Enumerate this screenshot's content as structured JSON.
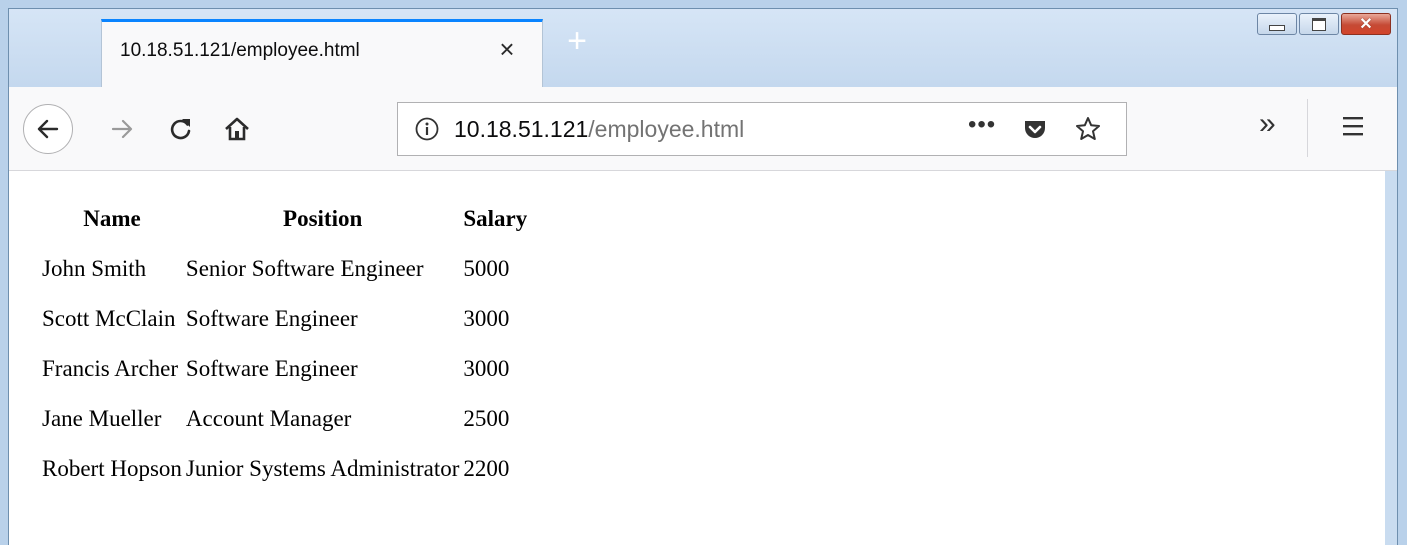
{
  "browser": {
    "tab": {
      "title": "10.18.51.121/employee.html",
      "close_glyph": "×"
    },
    "new_tab_glyph": "+",
    "url": {
      "host": "10.18.51.121",
      "path": "/employee.html"
    },
    "url_actions": {
      "more_glyph": "•••"
    },
    "overflow_glyph": "»",
    "accent_color": "#0a84ff"
  },
  "table": {
    "headers": [
      "Name",
      "Position",
      "Salary"
    ],
    "rows": [
      [
        "John Smith",
        "Senior Software Engineer",
        "5000"
      ],
      [
        "Scott McClain",
        "Software Engineer",
        "3000"
      ],
      [
        "Francis Archer",
        "Software Engineer",
        "3000"
      ],
      [
        "Jane Mueller",
        "Account Manager",
        "2500"
      ],
      [
        "Robert Hopson",
        "Junior Systems Administrator",
        "2200"
      ]
    ]
  }
}
